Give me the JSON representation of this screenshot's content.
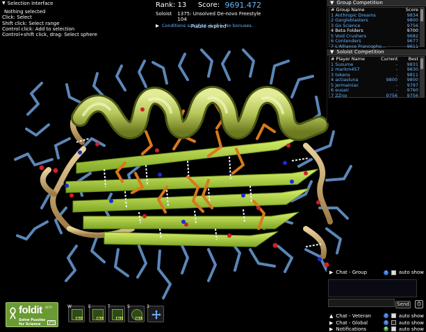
{
  "selection": {
    "title": "Selection Interface",
    "lines": [
      "Nothing selected",
      "Click: Select",
      "Shift click: Select range",
      "Control click: Add to selection",
      "Control+shift click, drag: Select sphere"
    ]
  },
  "score_panel": {
    "rank_label": "Rank: 13",
    "score_label": "Score:",
    "score_value": "9691.472",
    "mode": "Soloist",
    "puzzle": "1375: Unsolved De-novo Freestyle 104",
    "status": "Puzzle expired",
    "conditions": "Conditions satisfied: 1 of 1. No bonuses."
  },
  "group_competition": {
    "title": "Group Competition",
    "col_name": "# Group Name",
    "col_score": "Score",
    "rows": [
      {
        "name": "1 Anthropic Dreams",
        "score": "9834",
        "selected": false
      },
      {
        "name": "2 Gargleblasters",
        "score": "9800",
        "selected": false
      },
      {
        "name": "3 Go Science",
        "score": "9756",
        "selected": false
      },
      {
        "name": "4 Beta Folders",
        "score": "9700",
        "selected": true
      },
      {
        "name": "5 Void Crushers",
        "score": "9682",
        "selected": false
      },
      {
        "name": "6 Contenders",
        "score": "9677",
        "selected": false
      },
      {
        "name": "7 L'Alliance Francopho...",
        "score": "9611",
        "selected": false
      }
    ]
  },
  "soloist_competition": {
    "title": "Soloist Competition",
    "col_name": "# Player Name",
    "col_current": "Current",
    "col_best": "Best",
    "rows": [
      {
        "name": "1 Susume",
        "current": "-",
        "best": "9831"
      },
      {
        "name": "2 markm457",
        "current": "-",
        "best": "9830"
      },
      {
        "name": "3 tokens",
        "current": "-",
        "best": "9811"
      },
      {
        "name": "4 actiasluna",
        "current": "9800",
        "best": "9800"
      },
      {
        "name": "5 jermainiac",
        "current": "-",
        "best": "9797"
      },
      {
        "name": "6 eusair",
        "current": "-",
        "best": "9760"
      },
      {
        "name": "7 ZZno",
        "current": "9756",
        "best": "9756"
      }
    ]
  },
  "chat": {
    "group": "Chat - Group",
    "veteran": "Chat - Veteran",
    "global": "Chat - Global",
    "notifications": "Notifications",
    "auto_show": "auto show",
    "send": "Send"
  },
  "logo": {
    "name": "foldit",
    "tagline1": "Solve Puzzles",
    "tagline2": "for Science",
    "version": "[H]",
    "tm": "BETA"
  },
  "tools": [
    {
      "key": "W",
      "label": "ALL"
    },
    {
      "key": "E",
      "label": "ALL"
    },
    {
      "key": "T",
      "label": "ALL"
    },
    {
      "key": "S",
      "label": "ALL"
    },
    {
      "key": "3",
      "label": ""
    }
  ],
  "colors": {
    "helix": "#b5c85a",
    "sheet": "#a9d43a",
    "loop": "#c8a872",
    "sidechain_blue": "#5b86b8",
    "sidechain_orange": "#d9791a",
    "score_blue": "#6ab4ff"
  }
}
